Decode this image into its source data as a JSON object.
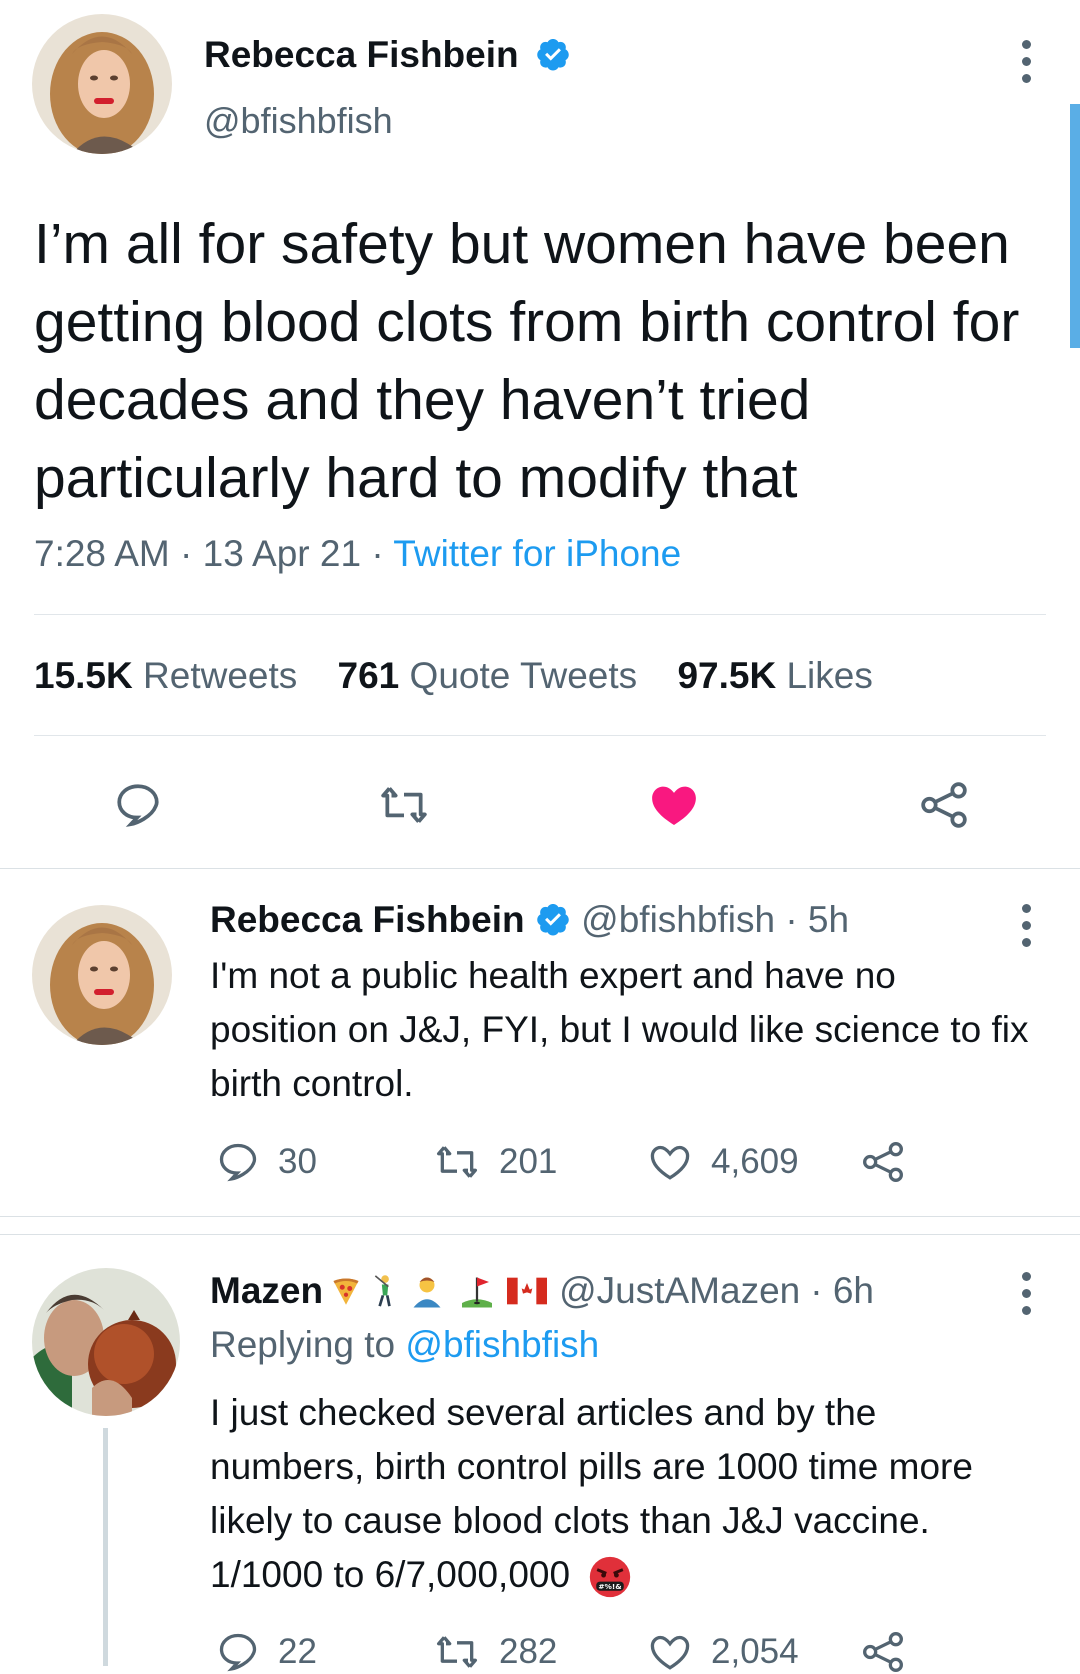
{
  "main_tweet": {
    "name": "Rebecca Fishbein",
    "handle": "@bfishbfish",
    "text": "I’m all for safety but women have been getting blood clots from birth control for decades and they haven’t tried particularly hard to modify that",
    "time": "7:28 AM",
    "date": "13 Apr 21",
    "source": "Twitter for iPhone",
    "sep": "·",
    "stats": {
      "retweets_count": "15.5K",
      "retweets_label": "Retweets",
      "quotes_count": "761",
      "quotes_label": "Quote Tweets",
      "likes_count": "97.5K",
      "likes_label": "Likes"
    },
    "liked": true
  },
  "reply_1": {
    "name": "Rebecca Fishbein",
    "handle": "@bfishbfish",
    "age": "· 5h",
    "text": "I'm not a public health expert and have no position on J&J, FYI, but I would like science to fix birth control.",
    "replies": "30",
    "retweets": "201",
    "likes": "4,609"
  },
  "reply_2": {
    "name": "Mazen",
    "handle": "@JustAMazen",
    "age": "· 6h",
    "replying_prefix": "Replying to",
    "replying_to": "@bfishbfish",
    "text": "I just checked several articles and by the numbers, birth control pills are 1000 time more likely to cause blood clots than J&J vaccine. 1/1000 to 6/7,000,000",
    "angry_emoji_label": "#%!&",
    "replies": "22",
    "retweets": "282",
    "likes": "2,054"
  },
  "colors": {
    "accent": "#1d9bf0",
    "like": "#f91880",
    "text": "#0f1419",
    "muted": "#536471"
  },
  "icons": [
    "verified-badge-icon",
    "more-options-icon",
    "reply-icon",
    "retweet-icon",
    "like-icon",
    "share-icon",
    "pizza-emoji",
    "golfer-emoji",
    "person-emoji",
    "golf-flag-emoji",
    "canada-flag-emoji",
    "angry-face-emoji"
  ]
}
